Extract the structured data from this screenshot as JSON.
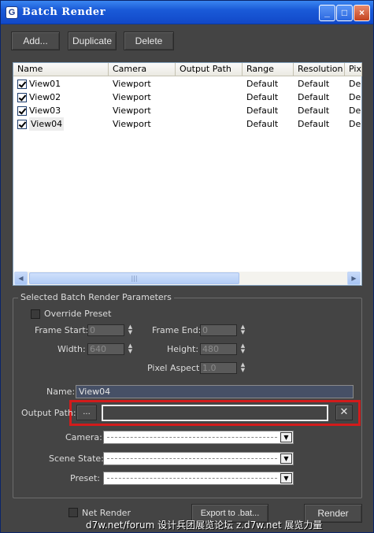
{
  "window": {
    "title": "Batch Render",
    "icon": "3dsmax-app-icon"
  },
  "titlebar": {
    "minimize": "_",
    "maximize": "□",
    "close": "×"
  },
  "toolbar": {
    "add": "Add...",
    "duplicate": "Duplicate",
    "delete": "Delete"
  },
  "list": {
    "columns": [
      "Name",
      "Camera",
      "Output Path",
      "Range",
      "Resolution",
      "Pix"
    ],
    "rows": [
      {
        "name": "View01",
        "camera": "Viewport",
        "output": "",
        "range": "Default",
        "resolution": "Default",
        "pix": "De"
      },
      {
        "name": "View02",
        "camera": "Viewport",
        "output": "",
        "range": "Default",
        "resolution": "Default",
        "pix": "De"
      },
      {
        "name": "View03",
        "camera": "Viewport",
        "output": "",
        "range": "Default",
        "resolution": "Default",
        "pix": "De"
      },
      {
        "name": "View04",
        "camera": "Viewport",
        "output": "",
        "range": "Default",
        "resolution": "Default",
        "pix": "De"
      }
    ],
    "scroll": {
      "left": "◀",
      "right": "▶",
      "grip": "|||"
    }
  },
  "params": {
    "group_label": "Selected Batch Render Parameters",
    "override_preset": "Override Preset",
    "frame_start_label": "Frame Start:",
    "frame_start": "0",
    "frame_end_label": "Frame End:",
    "frame_end": "0",
    "width_label": "Width:",
    "width": "640",
    "height_label": "Height:",
    "height": "480",
    "pixel_aspect_label": "Pixel Aspect:",
    "pixel_aspect": "1.0",
    "name_label": "Name:",
    "name": "View04",
    "output_path_label": "Output Path:",
    "browse": "...",
    "clear": "✕",
    "camera_label": "Camera:",
    "scene_state_label": "Scene State:",
    "preset_label": "Preset:",
    "combo_arrow": "▼"
  },
  "footer": {
    "net_render": "Net Render",
    "export": "Export to .bat...",
    "render": "Render"
  },
  "watermark": "d7w.net/forum 设计兵团展览论坛   z.d7w.net 展览力量",
  "colors": {
    "highlight": "#d21b1b",
    "panel": "#444444",
    "titlebar": "#1a5ad8"
  }
}
